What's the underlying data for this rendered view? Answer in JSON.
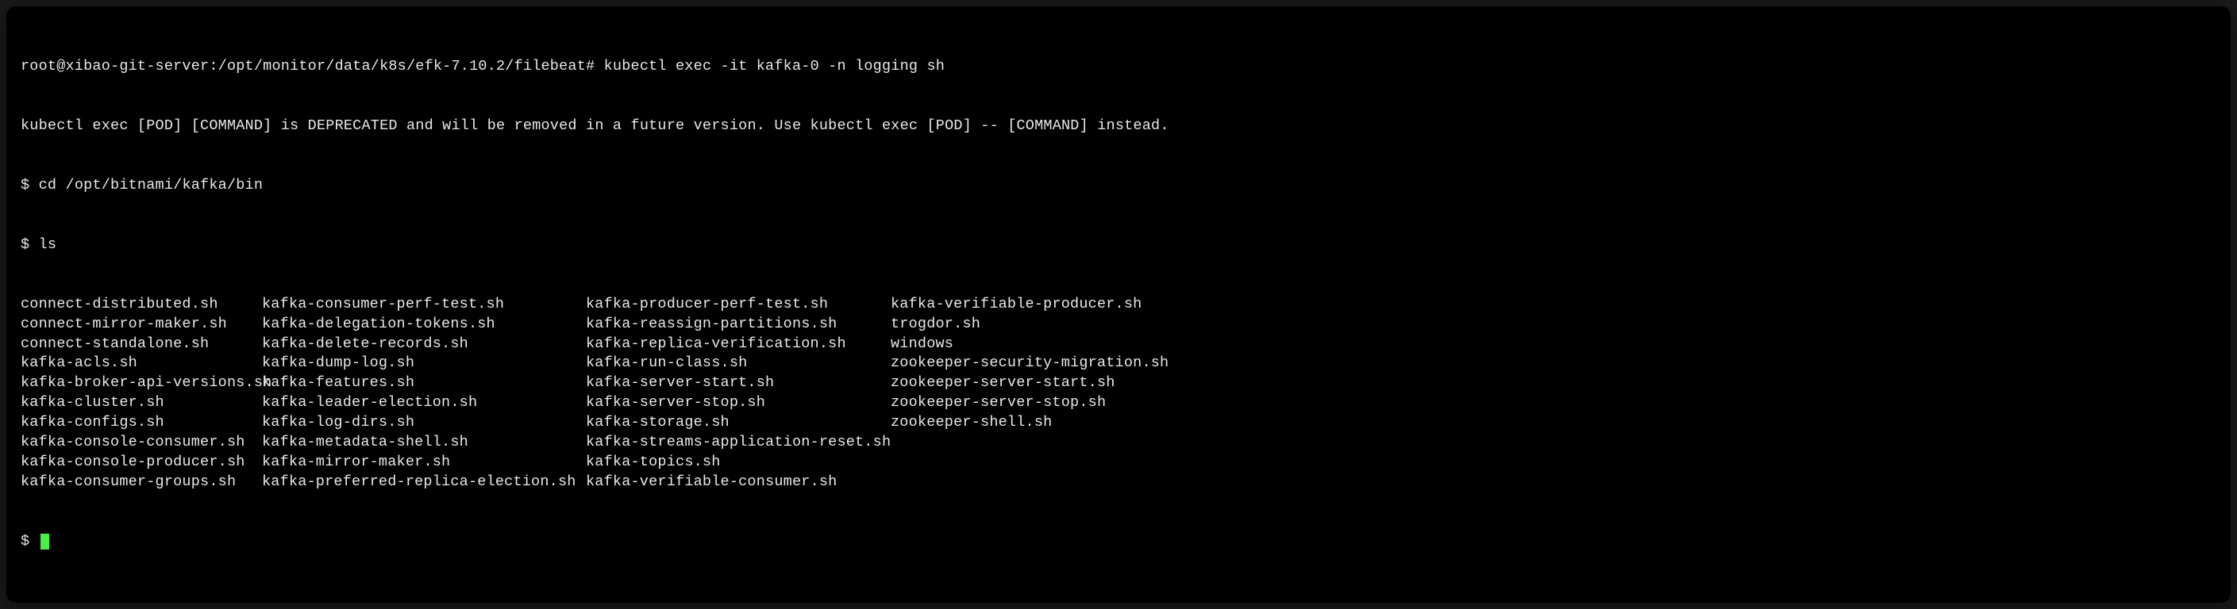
{
  "terminal": {
    "line1_prompt": "root@xibao-git-server:/opt/monitor/data/k8s/efk-7.10.2/filebeat# ",
    "line1_cmd": "kubectl exec -it kafka-0 -n logging sh",
    "line2_warning": "kubectl exec [POD] [COMMAND] is DEPRECATED and will be removed in a future version. Use kubectl exec [POD] -- [COMMAND] instead.",
    "line3_prompt": "$ ",
    "line3_cmd": "cd /opt/bitnami/kafka/bin",
    "line4_prompt": "$ ",
    "line4_cmd": "ls",
    "ls_files": {
      "col1": [
        "connect-distributed.sh",
        "connect-mirror-maker.sh",
        "connect-standalone.sh",
        "kafka-acls.sh",
        "kafka-broker-api-versions.sh",
        "kafka-cluster.sh",
        "kafka-configs.sh",
        "kafka-console-consumer.sh",
        "kafka-console-producer.sh",
        "kafka-consumer-groups.sh"
      ],
      "col2": [
        "kafka-consumer-perf-test.sh",
        "kafka-delegation-tokens.sh",
        "kafka-delete-records.sh",
        "kafka-dump-log.sh",
        "kafka-features.sh",
        "kafka-leader-election.sh",
        "kafka-log-dirs.sh",
        "kafka-metadata-shell.sh",
        "kafka-mirror-maker.sh",
        "kafka-preferred-replica-election.sh"
      ],
      "col3": [
        "kafka-producer-perf-test.sh",
        "kafka-reassign-partitions.sh",
        "kafka-replica-verification.sh",
        "kafka-run-class.sh",
        "kafka-server-start.sh",
        "kafka-server-stop.sh",
        "kafka-storage.sh",
        "kafka-streams-application-reset.sh",
        "kafka-topics.sh",
        "kafka-verifiable-consumer.sh"
      ],
      "col4": [
        "kafka-verifiable-producer.sh",
        "trogdor.sh",
        "windows",
        "zookeeper-security-migration.sh",
        "zookeeper-server-start.sh",
        "zookeeper-server-stop.sh",
        "zookeeper-shell.sh"
      ]
    },
    "final_prompt": "$ "
  }
}
